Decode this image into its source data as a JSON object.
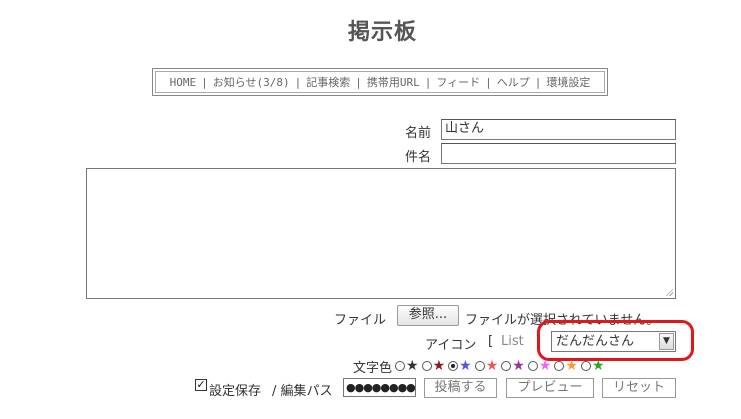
{
  "page": {
    "title": "掲示板"
  },
  "nav": {
    "items": [
      "HOME",
      "お知らせ(3/8)",
      "記事検索",
      "携帯用URL",
      "フィード",
      "ヘルプ",
      "環境設定"
    ],
    "separator": "|"
  },
  "form": {
    "name_label": "名前",
    "name_value": "山さん",
    "subject_label": "件名",
    "subject_value": "",
    "body_value": "",
    "file_label": "ファイル",
    "file_button": "参照...",
    "file_status": "ファイルが選択されていません。",
    "icon_label": "アイコン",
    "icon_bracket": "[",
    "icon_list_link": "List",
    "icon_selected": "だんだんさん",
    "color_label": "文字色",
    "colors": [
      "#333333",
      "#8b1a1a",
      "#5555dd",
      "#ee5555",
      "#993399",
      "#ee66ee",
      "#ff9933",
      "#22aa22"
    ],
    "color_selected_index": 2,
    "save_settings_checked": true,
    "save_settings_label": "設定保存",
    "edit_pass_label": "/ 編集パス",
    "edit_pass_value": "●●●●●●●●●",
    "submit_button": "投稿する",
    "preview_button": "プレビュー",
    "reset_button": "リセット"
  },
  "annotation": {
    "color": "#e3151d"
  }
}
